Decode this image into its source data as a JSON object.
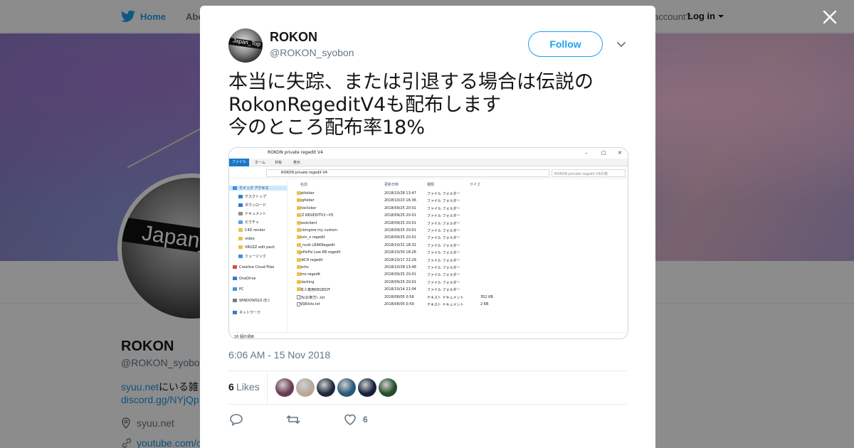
{
  "topnav": {
    "home_label": "Home",
    "about_label": "Abo",
    "account_text": "account?",
    "login_label": "Log in"
  },
  "profile": {
    "avatar_text": "Japan_",
    "name": "ROKON",
    "handle": "@ROKON_syobo",
    "bio_link": "syuu.net",
    "bio_text": "にいる雑",
    "bio_link2": "discord.gg/NYjQp",
    "location": "syuu.net",
    "url": "youtube.com/c"
  },
  "tweet": {
    "author_name": "ROKON",
    "author_handle": "@ROKON_syobon",
    "avatar_text": "Japan_Top",
    "follow_label": "Follow",
    "text": "本当に失踪、または引退する場合は伝説の\nRokonRegeditV4も配布します\n今のところ配布率18%",
    "timestamp": "6:06 AM - 15 Nov 2018",
    "likes_count": "6",
    "likes_label": "Likes",
    "like_action_count": "6"
  },
  "explorer": {
    "window_title": "ROKON private regedit V4",
    "ribbon_tabs": [
      "ファイル",
      "ホーム",
      "共有",
      "表示"
    ],
    "address": "ROKON private regedit V4",
    "search_placeholder": "ROKON private regedit V4の検",
    "columns": {
      "name": "名前",
      "date": "更新日時",
      "type": "種類",
      "size": "サイズ"
    },
    "nav": [
      {
        "label": "クイック アクセス",
        "selected": true
      },
      {
        "label": "デスクトップ"
      },
      {
        "label": "ダウンロード"
      },
      {
        "label": "ドキュメント"
      },
      {
        "label": "ピクチャ"
      },
      {
        "label": "C4D render"
      },
      {
        "label": "video"
      },
      {
        "label": "VRUZZ edit pack"
      },
      {
        "label": "ミュージック"
      },
      {
        "label": "Creative Cloud Files"
      },
      {
        "label": "OneDrive"
      },
      {
        "label": "PC"
      },
      {
        "label": "WINDOWS10 (E:)"
      },
      {
        "label": "ネットワーク"
      }
    ],
    "rows": [
      {
        "name": "!batfolder",
        "date": "2018/10/28 13:47",
        "type": "ファイル フォルダー",
        "size": "",
        "kind": "folder"
      },
      {
        "name": "!regfolder",
        "date": "2018/10/23 16:36",
        "type": "ファイル フォルダー",
        "size": "",
        "kind": "folder"
      },
      {
        "name": "autoclicker",
        "date": "2018/09/25 20:01",
        "type": "ファイル フォルダー",
        "size": "",
        "kind": "folder"
      },
      {
        "name": "BCZ REGEDITV1~V5",
        "date": "2018/09/25 20:01",
        "type": "ファイル フォルダー",
        "size": "",
        "kind": "folder"
      },
      {
        "name": "Ghostclient",
        "date": "2018/09/25 20:01",
        "type": "ファイル フォルダー",
        "size": "",
        "kind": "folder"
      },
      {
        "name": "hackingme my custom",
        "date": "2018/09/25 20:01",
        "type": "ファイル フォルダー",
        "size": "",
        "kind": "folder"
      },
      {
        "name": "ikevin_x regedit",
        "date": "2018/09/25 20:01",
        "type": "ファイル フォルダー",
        "size": "",
        "kind": "folder"
      },
      {
        "name": "Lc_ncoh LEAKRegedit",
        "date": "2018/10/31 18:32",
        "type": "ファイル フォルダー",
        "size": "",
        "kind": "folder"
      },
      {
        "name": "p_xPsiPsi Low KB regedit",
        "date": "2018/10/30 18:26",
        "type": "ファイル フォルダー",
        "size": "",
        "kind": "folder"
      },
      {
        "name": "REACH regedit",
        "date": "2018/10/17 22:29",
        "type": "ファイル フォルダー",
        "size": "",
        "kind": "folder"
      },
      {
        "name": "reachs",
        "date": "2018/10/28 13:48",
        "type": "ファイル フォルダー",
        "size": "",
        "kind": "folder"
      },
      {
        "name": "sumo regedit",
        "date": "2018/09/25 20:01",
        "type": "ファイル フォルダー",
        "size": "",
        "kind": "folder"
      },
      {
        "name": "Zblacking",
        "date": "2018/09/25 20:01",
        "type": "ファイル フォルダー",
        "size": "",
        "kind": "folder"
      },
      {
        "name": "日本人専用REGEDIT",
        "date": "2018/10/14 21:04",
        "type": "ファイル フォルダー",
        "size": "",
        "kind": "folder"
      },
      {
        "name": "ALTs(お楽方) .txt",
        "date": "2018/08/05 0:58",
        "type": "テキスト ドキュメント",
        "size": "352 KB",
        "kind": "file"
      },
      {
        "name": "DNSRlists.txt",
        "date": "2018/08/05 0:59",
        "type": "テキスト ドキュメント",
        "size": "2 KB",
        "kind": "file"
      }
    ],
    "status": "16 個の項目"
  },
  "colors": {
    "accent": "#1da1f2",
    "link": "#1b95e0",
    "muted": "#657786"
  },
  "likers": [
    {
      "color": "#6b3a4f"
    },
    {
      "color": "#b7a89a"
    },
    {
      "color": "#1e2a3c"
    },
    {
      "color": "#2a5878"
    },
    {
      "color": "#15203a"
    },
    {
      "color": "#234d2b"
    }
  ]
}
